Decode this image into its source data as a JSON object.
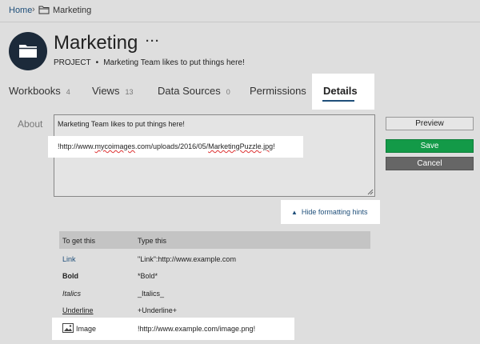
{
  "breadcrumb": {
    "home": "Home",
    "separator": "›",
    "current": "Marketing"
  },
  "project": {
    "name": "Marketing",
    "more": "···",
    "type": "PROJECT",
    "separator": "•",
    "description": "Marketing Team likes to put things here!"
  },
  "tabs": [
    {
      "label": "Workbooks",
      "count": "4"
    },
    {
      "label": "Views",
      "count": "13"
    },
    {
      "label": "Data Sources",
      "count": "0"
    },
    {
      "label": "Permissions"
    },
    {
      "label": "Details",
      "active": true
    }
  ],
  "about": {
    "label": "About",
    "line1": "Marketing Team likes to put things here!",
    "url_parts": {
      "pre": "!http://www.",
      "word1": "mycoimages",
      "mid": ".com/uploads/2016/05/",
      "word2": "MarketingPuzzle",
      "dot": ".",
      "word3": "jpg",
      "end": "!"
    }
  },
  "buttons": {
    "preview": "Preview",
    "save": "Save",
    "cancel": "Cancel"
  },
  "hints_toggle": {
    "chevron": "▲",
    "label": "Hide formatting hints"
  },
  "hints_table": {
    "headers": [
      "To get this",
      "Type this"
    ],
    "rows": [
      {
        "label": "Link",
        "syntax": "\"Link\":http://www.example.com"
      },
      {
        "label": "Bold",
        "syntax": "*Bold*"
      },
      {
        "label": "Italics",
        "syntax": "_Italics_"
      },
      {
        "label": "Underline",
        "syntax": "+Underline+"
      },
      {
        "label": "Image",
        "syntax": "!http://www.example.com/image.png!"
      }
    ]
  },
  "colors": {
    "accent": "#1f4f7a",
    "save_button": "#139a48",
    "cancel_button": "#666666",
    "avatar": "#1c2a3a"
  },
  "icons": {
    "breadcrumb": "folder-icon",
    "avatar": "folder-icon",
    "image_row": "image-icon"
  }
}
